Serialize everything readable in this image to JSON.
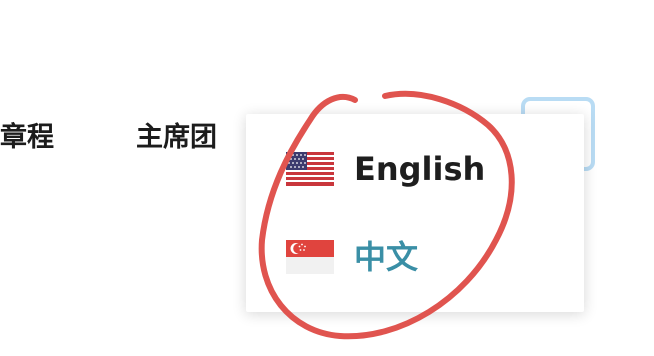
{
  "nav": {
    "items": [
      {
        "label": "章程"
      },
      {
        "label": "主席团"
      }
    ]
  },
  "language_menu": {
    "options": [
      {
        "label": "English",
        "flag": "us-flag-icon",
        "selected": false
      },
      {
        "label": "中文",
        "flag": "singapore-flag-icon",
        "selected": true
      }
    ]
  },
  "colors": {
    "nav_text": "#1c1c1c",
    "option_text": "#1e1e1e",
    "selected_option_text": "#3a8fa6",
    "toggle_border": "#b9dcf4",
    "annotation_stroke": "#e0544f"
  }
}
